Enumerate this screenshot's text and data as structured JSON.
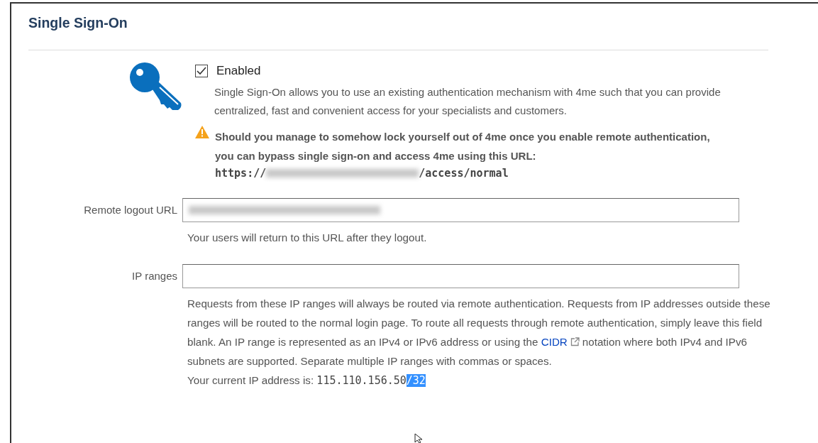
{
  "title": "Single Sign-On",
  "enabled": {
    "label": "Enabled",
    "checked": true
  },
  "description": "Single Sign-On allows you to use an existing authentication mechanism with 4me such that you can provide centralized, fast and convenient access for your specialists and customers.",
  "warning": {
    "text": "Should you manage to somehow lock yourself out of 4me once you enable remote authentication, you can bypass single sign-on and access 4me using this URL:",
    "url_start": "https://",
    "url_end": "/access/normal"
  },
  "fields": [
    {
      "label": "Remote logout URL",
      "redacted_value": true,
      "help": "Your users will return to this URL after they logout."
    },
    {
      "label": "IP ranges",
      "redacted_value": false,
      "help_before": "Requests from these IP ranges will always be routed via remote authentication. Requests from IP addresses outside these ranges will be routed to the normal login page. To route all requests through remote authentication, simply leave this field blank. An IP range is represented as an IPv4 or IPv6 address or using the",
      "link": "CIDR",
      "help_after": "notation where both IPv4 and IPv6 subnets are supported. Separate multiple IP ranges with commas or spaces.",
      "ip_label": "Your current IP address is:",
      "ip_parts": [
        {
          "text": "115.110.156.50",
          "selected": false
        },
        {
          "text": "/32",
          "selected": true
        }
      ]
    }
  ]
}
